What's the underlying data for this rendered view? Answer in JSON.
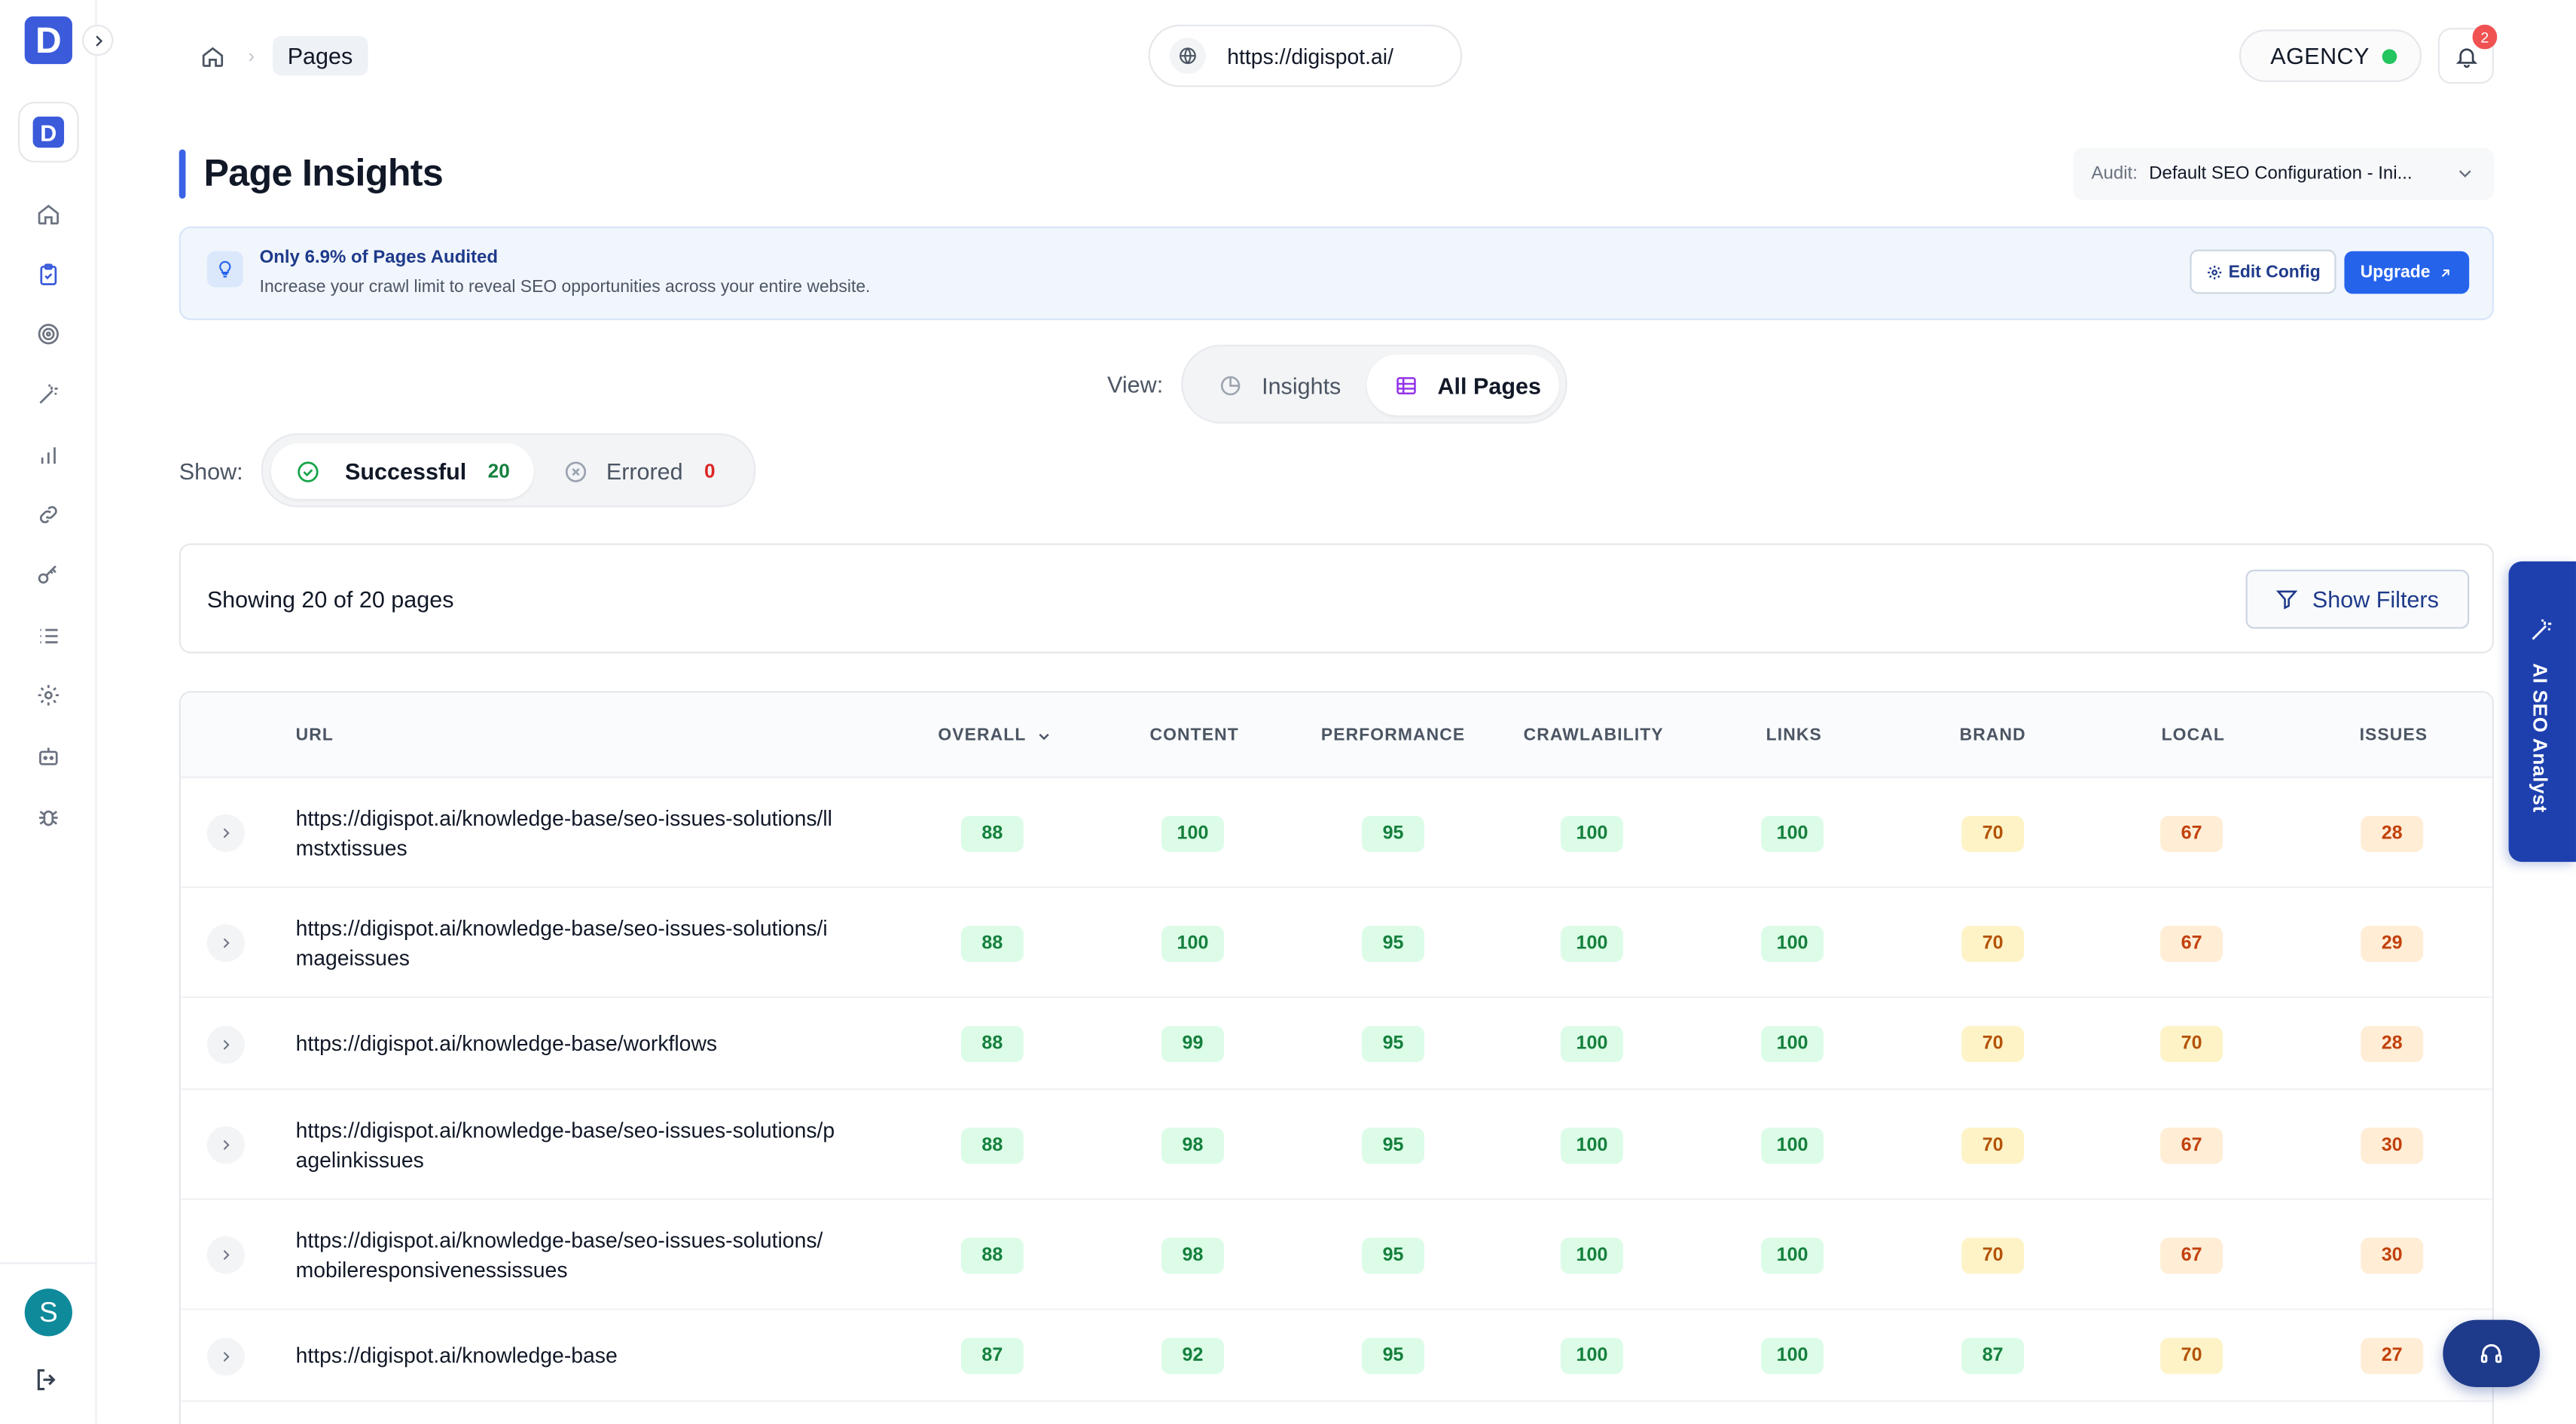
{
  "app": {
    "logo_letter": "D",
    "workspace_letter": "D",
    "user_initial": "S"
  },
  "breadcrumb": {
    "current": "Pages"
  },
  "site": {
    "url": "https://digispot.ai/"
  },
  "plan": {
    "label": "AGENCY"
  },
  "notifications": {
    "count": "2"
  },
  "page": {
    "title": "Page Insights"
  },
  "audit": {
    "label": "Audit:",
    "value": "Default SEO Configuration - Ini..."
  },
  "banner": {
    "title": "Only 6.9% of Pages Audited",
    "desc": "Increase your crawl limit to reveal SEO opportunities across your entire website.",
    "edit_label": "Edit Config",
    "upgrade_label": "Upgrade"
  },
  "view": {
    "label": "View:",
    "insights": "Insights",
    "all_pages": "All Pages"
  },
  "show": {
    "label": "Show:",
    "successful": "Successful",
    "successful_count": "20",
    "errored": "Errored",
    "errored_count": "0"
  },
  "summary": {
    "text": "Showing 20 of 20 pages",
    "filters_label": "Show Filters"
  },
  "table": {
    "headers": [
      "URL",
      "OVERALL",
      "CONTENT",
      "PERFORMANCE",
      "CRAWLABILITY",
      "LINKS",
      "BRAND",
      "LOCAL",
      "ISSUES"
    ],
    "rows": [
      {
        "url": "https://digispot.ai/knowledge-base/seo-issues-solutions/llmstxtissues",
        "scores": [
          "88",
          "100",
          "95",
          "100",
          "100",
          "70",
          "67",
          "28"
        ]
      },
      {
        "url": "https://digispot.ai/knowledge-base/seo-issues-solutions/imageissues",
        "scores": [
          "88",
          "100",
          "95",
          "100",
          "100",
          "70",
          "67",
          "29"
        ]
      },
      {
        "url": "https://digispot.ai/knowledge-base/workflows",
        "scores": [
          "88",
          "99",
          "95",
          "100",
          "100",
          "70",
          "70",
          "28"
        ]
      },
      {
        "url": "https://digispot.ai/knowledge-base/seo-issues-solutions/pagelinkissues",
        "scores": [
          "88",
          "98",
          "95",
          "100",
          "100",
          "70",
          "67",
          "30"
        ]
      },
      {
        "url": "https://digispot.ai/knowledge-base/seo-issues-solutions/mobileresponsivenessissues",
        "scores": [
          "88",
          "98",
          "95",
          "100",
          "100",
          "70",
          "67",
          "30"
        ]
      },
      {
        "url": "https://digispot.ai/knowledge-base",
        "scores": [
          "87",
          "92",
          "95",
          "100",
          "100",
          "87",
          "70",
          "27"
        ]
      }
    ]
  },
  "ai_tab": {
    "label": "AI SEO Analyst"
  },
  "colors": {
    "accent": "#2563eb",
    "brand": "#3b5bdb",
    "good": "#15803d",
    "warn": "#b45309",
    "bad": "#c2410c"
  }
}
